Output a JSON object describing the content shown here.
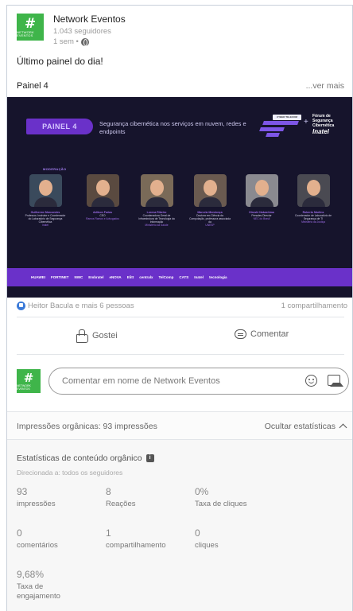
{
  "post": {
    "org_name": "Network Eventos",
    "logo_hash": "#",
    "logo_text": "NETWORK EVENTOS",
    "followers": "1.043 seguidores",
    "time": "1 sem •",
    "text": "Último painel do dia!",
    "document_title": "Painel 4",
    "see_more": "...ver mais"
  },
  "banner": {
    "panel_label": "PAINEL 4",
    "subtitle": "Segurança cibernética nos serviços em nuvem, redes e endpoints",
    "event_logo_text": "CYBER TELECOM",
    "forum_text": "Fórum de Segurança Cibernética",
    "forum_brand": "Inatel",
    "moderation_label": "MODERAÇÃO",
    "speakers": [
      {
        "name": "Guilherme Marcondes",
        "role": "Professor, Instrutor e Coordenador do Laboratório de Segurança Cibernética",
        "org": "Inatel",
        "bg": "#3a4a5c"
      },
      {
        "name": "Adilson Farias",
        "role": "CEO",
        "org": "Ramos Ramos e Advogados",
        "bg": "#5a4a40"
      },
      {
        "name": "Lorena Ribeiro",
        "role": "Coordenadora Geral de Infraestrutura de Tecnologia da Informação",
        "org": "Ministério da Saúde",
        "bg": "#7a6a58"
      },
      {
        "name": "Marcela Mendonça",
        "role": "Doutora em Ciência da Computação, professora associada da",
        "org": "UNESP",
        "bg": "#6a5a50"
      },
      {
        "name": "Hiroshi Nakashima",
        "role": "Presales Director",
        "org": "NEC do Brasil",
        "bg": "#8a8a90"
      },
      {
        "name": "Roberto Martins",
        "role": "Coordenador de Laboratório de Segurança de TI",
        "org": "Ministério da Justiça",
        "bg": "#4a4a52"
      }
    ],
    "sponsors": [
      "HUAWEI",
      "FORTINET",
      "NWC",
      "Embratel",
      "eNOVA",
      "Elitt",
      "centralx",
      "TelComp",
      "CATS",
      "Inatel",
      "tecnologia"
    ]
  },
  "social": {
    "reactions_text": "Heitor Bacula e mais 6 pessoas",
    "shares_text": "1 compartilhamento",
    "like_label": "Gostei",
    "comment_label": "Comentar",
    "comment_placeholder": "Comentar em nome de Network Eventos"
  },
  "stats": {
    "impressions_summary": "Impressões orgânicas: 93 impressões",
    "hide_label": "Ocultar estatísticas",
    "title": "Estatísticas de conteúdo orgânico",
    "info_glyph": "i",
    "audience": "Direcionada a: todos os seguidores",
    "items": [
      {
        "value": "93",
        "label": "impressões"
      },
      {
        "value": "8",
        "label": "Reações"
      },
      {
        "value": "0%",
        "label": "Taxa de cliques"
      },
      {
        "value": "0",
        "label": "comentários"
      },
      {
        "value": "1",
        "label": "compartilhamento"
      },
      {
        "value": "0",
        "label": "cliques"
      },
      {
        "value": "9,68%",
        "label": "Taxa de engajamento"
      }
    ]
  },
  "colors": {
    "brand_green": "#3fb54a",
    "banner_bg": "#16142c",
    "banner_purple": "#6a31c9",
    "like_blue": "#3b7ad8"
  }
}
